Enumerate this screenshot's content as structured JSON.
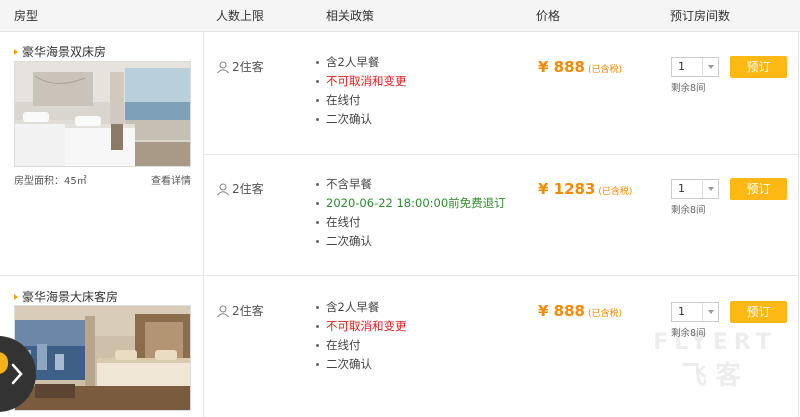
{
  "header": {
    "col_room": "房型",
    "col_capacity": "人数上限",
    "col_policy": "相关政策",
    "col_price": "价格",
    "col_qty": "预订房间数"
  },
  "rooms": [
    {
      "name": "豪华海景双床房",
      "area_label": "房型面积：45㎡",
      "detail_link": "查看详情",
      "rates": [
        {
          "capacity": "2住客",
          "policies": [
            "含2人早餐",
            "不可取消和变更",
            "在线付",
            "二次确认"
          ],
          "price": "¥ 888",
          "tax": "(已含税)",
          "qty": "1",
          "remain": "剩余8间",
          "book": "预订"
        },
        {
          "capacity": "2住客",
          "policies": [
            "不含早餐",
            "2020-06-22 18:00:00前免费退订",
            "在线付",
            "二次确认"
          ],
          "price": "¥ 1283",
          "tax": "(已含税)",
          "qty": "1",
          "remain": "剩余8间",
          "book": "预订"
        }
      ]
    },
    {
      "name": "豪华海景大床客房",
      "rates": [
        {
          "capacity": "2住客",
          "policies": [
            "含2人早餐",
            "不可取消和变更",
            "在线付",
            "二次确认"
          ],
          "price": "¥ 888",
          "tax": "(已含税)",
          "qty": "1",
          "remain": "剩余8间",
          "book": "预订"
        }
      ]
    }
  ],
  "watermark": {
    "line1": "FLYERT",
    "line2": "飞客"
  },
  "colors": {
    "accent": "#f58a00",
    "book_button": "#fdb813",
    "no_cancel": "#e02020",
    "free_cancel": "#2e8b2e"
  },
  "icons": {
    "capacity": "person-icon",
    "floating": "chevron-right-icon"
  }
}
